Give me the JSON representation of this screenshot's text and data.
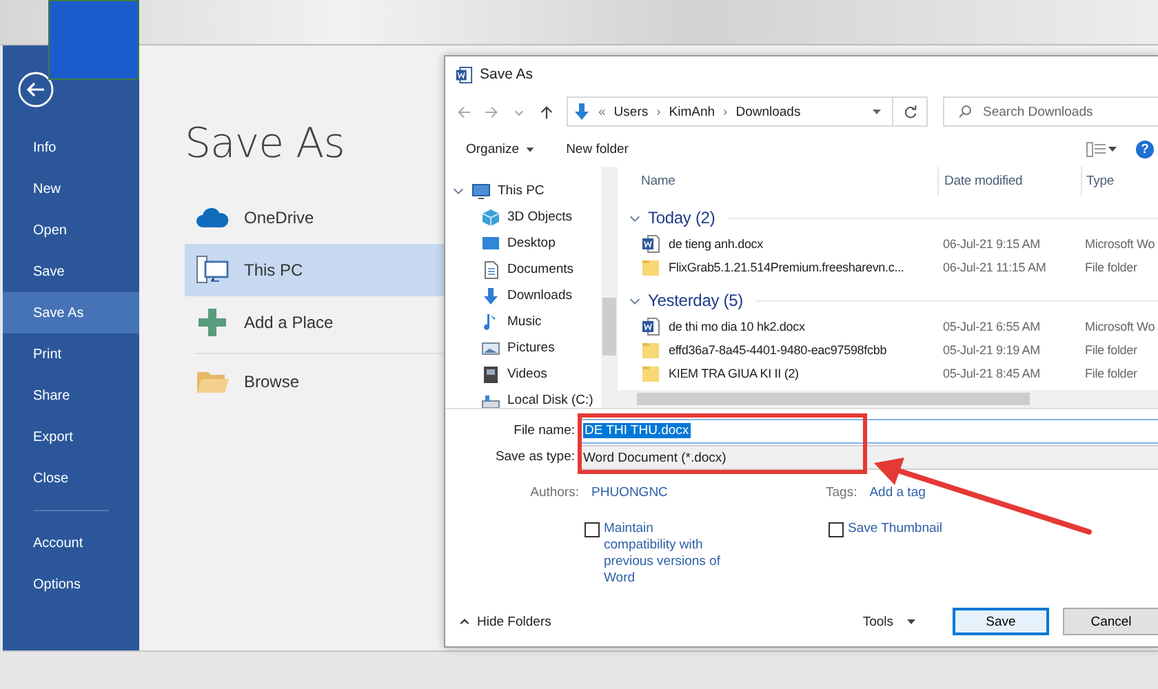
{
  "sidebar": {
    "items": [
      {
        "label": "Info",
        "selected": false
      },
      {
        "label": "New",
        "selected": false
      },
      {
        "label": "Open",
        "selected": false
      },
      {
        "label": "Save",
        "selected": false
      },
      {
        "label": "Save As",
        "selected": true
      },
      {
        "label": "Print",
        "selected": false
      },
      {
        "label": "Share",
        "selected": false
      },
      {
        "label": "Export",
        "selected": false
      },
      {
        "label": "Close",
        "selected": false
      }
    ],
    "bottom_items": [
      {
        "label": "Account",
        "selected": false
      },
      {
        "label": "Options",
        "selected": false
      }
    ]
  },
  "backstage": {
    "title": "Save As",
    "places": [
      {
        "label": "OneDrive",
        "kind": "cloud",
        "selected": false
      },
      {
        "label": "This PC",
        "kind": "pc",
        "selected": true
      },
      {
        "label": "Add a Place",
        "kind": "plus",
        "selected": false
      },
      {
        "label": "Browse",
        "kind": "folder",
        "selected": false
      }
    ]
  },
  "dialog": {
    "title": "Save As",
    "address": {
      "overflow_mark": "«",
      "separator": "›",
      "path": [
        "Users",
        "KimAnh",
        "Downloads"
      ]
    },
    "search": {
      "placeholder": "Search Downloads"
    },
    "toolbar": {
      "organize": "Organize",
      "new_folder": "New folder",
      "help": "?"
    },
    "tree": [
      {
        "label": "This PC",
        "kind": "pc",
        "expanded": true,
        "children": [
          {
            "label": "3D Objects",
            "kind": "cube"
          },
          {
            "label": "Desktop",
            "kind": "desktop"
          },
          {
            "label": "Documents",
            "kind": "docs"
          },
          {
            "label": "Downloads",
            "kind": "download"
          },
          {
            "label": "Music",
            "kind": "music"
          },
          {
            "label": "Pictures",
            "kind": "pictures"
          },
          {
            "label": "Videos",
            "kind": "videos"
          },
          {
            "label": "Local Disk (C:)",
            "kind": "disk"
          }
        ]
      }
    ],
    "file_list": {
      "columns": [
        "Name",
        "Date modified",
        "Type"
      ],
      "groups": [
        {
          "label": "Today (2)",
          "expanded": true,
          "files": [
            {
              "name": "de tieng anh.docx",
              "date": "06-Jul-21 9:15 AM",
              "type": "Microsoft Wo",
              "kind": "doc"
            },
            {
              "name": "FlixGrab5.1.21.514Premium.freesharevn.c...",
              "date": "06-Jul-21 11:15 AM",
              "type": "File folder",
              "kind": "folder"
            }
          ]
        },
        {
          "label": "Yesterday (5)",
          "expanded": true,
          "files": [
            {
              "name": "de thi mo dia 10 hk2.docx",
              "date": "05-Jul-21 6:55 AM",
              "type": "Microsoft Wo",
              "kind": "doc"
            },
            {
              "name": "effd36a7-8a45-4401-9480-eac97598fcbb",
              "date": "05-Jul-21 9:19 AM",
              "type": "File folder",
              "kind": "folder"
            },
            {
              "name": "KIEM TRA GIUA KI II (2)",
              "date": "05-Jul-21 8:45 AM",
              "type": "File folder",
              "kind": "folder"
            }
          ]
        }
      ]
    },
    "file_name": {
      "label": "File name:",
      "value": "DE THI THU.docx",
      "selected": true
    },
    "save_type": {
      "label": "Save as type:",
      "value": "Word Document (*.docx)"
    },
    "authors": {
      "label": "Authors:",
      "value": "PHUONGNC"
    },
    "tags": {
      "label": "Tags:",
      "value": "Add a tag"
    },
    "options": [
      {
        "label": "Maintain compatibility with previous versions of Word",
        "checked": false
      },
      {
        "label": "Save Thumbnail",
        "checked": false
      }
    ],
    "hide_folders": "Hide Folders",
    "tools": "Tools",
    "buttons": [
      {
        "label": "Save",
        "default": true
      },
      {
        "label": "Cancel",
        "default": false
      }
    ]
  }
}
